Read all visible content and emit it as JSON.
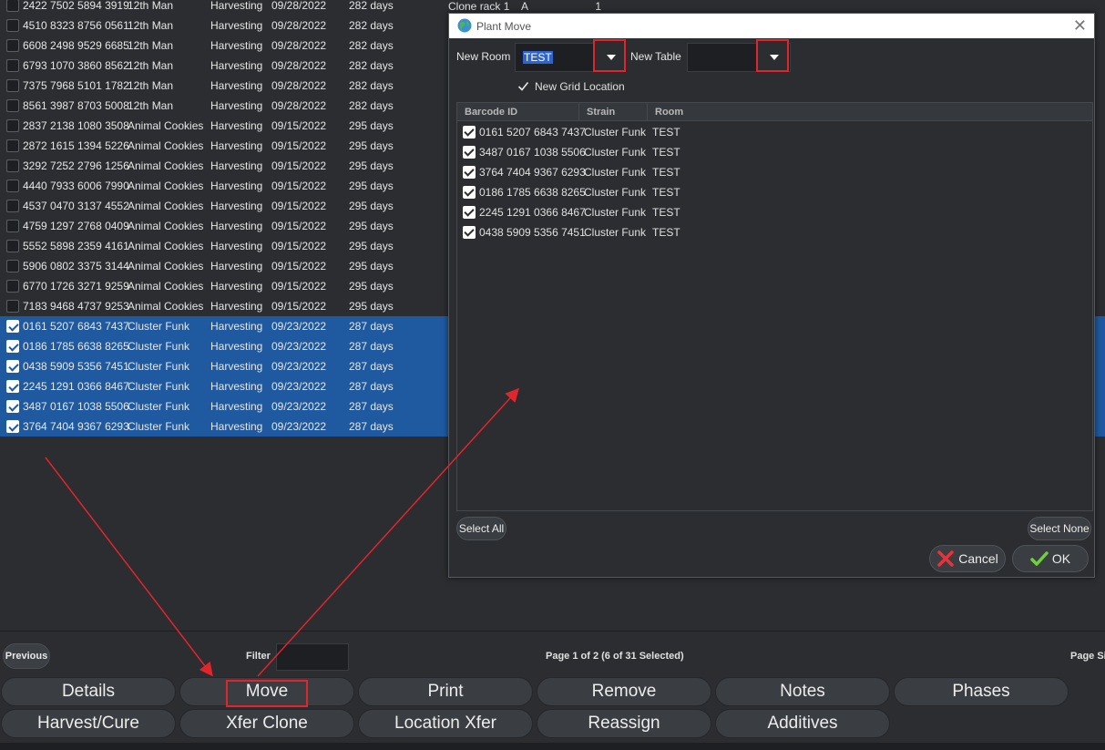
{
  "background_table": {
    "extra": [
      "Clone rack 1",
      "A",
      "1"
    ],
    "rows": [
      {
        "barcode": "2422 7502 5894 3919",
        "strain": "12th Man",
        "phase": "Harvesting",
        "date": "09/28/2022",
        "days": "282 days",
        "checked": false
      },
      {
        "barcode": "4510 8323 8756 0561",
        "strain": "12th Man",
        "phase": "Harvesting",
        "date": "09/28/2022",
        "days": "282 days",
        "checked": false
      },
      {
        "barcode": "6608 2498 9529 6685",
        "strain": "12th Man",
        "phase": "Harvesting",
        "date": "09/28/2022",
        "days": "282 days",
        "checked": false
      },
      {
        "barcode": "6793 1070 3860 8562",
        "strain": "12th Man",
        "phase": "Harvesting",
        "date": "09/28/2022",
        "days": "282 days",
        "checked": false
      },
      {
        "barcode": "7375 7968 5101 1782",
        "strain": "12th Man",
        "phase": "Harvesting",
        "date": "09/28/2022",
        "days": "282 days",
        "checked": false
      },
      {
        "barcode": "8561 3987 8703 5008",
        "strain": "12th Man",
        "phase": "Harvesting",
        "date": "09/28/2022",
        "days": "282 days",
        "checked": false
      },
      {
        "barcode": "2837 2138 1080 3508",
        "strain": "Animal Cookies",
        "phase": "Harvesting",
        "date": "09/15/2022",
        "days": "295 days",
        "checked": false
      },
      {
        "barcode": "2872 1615 1394 5226",
        "strain": "Animal Cookies",
        "phase": "Harvesting",
        "date": "09/15/2022",
        "days": "295 days",
        "checked": false
      },
      {
        "barcode": "3292 7252 2796 1256",
        "strain": "Animal Cookies",
        "phase": "Harvesting",
        "date": "09/15/2022",
        "days": "295 days",
        "checked": false
      },
      {
        "barcode": "4440 7933 6006 7990",
        "strain": "Animal Cookies",
        "phase": "Harvesting",
        "date": "09/15/2022",
        "days": "295 days",
        "checked": false
      },
      {
        "barcode": "4537 0470 3137 4552",
        "strain": "Animal Cookies",
        "phase": "Harvesting",
        "date": "09/15/2022",
        "days": "295 days",
        "checked": false
      },
      {
        "barcode": "4759 1297 2768 0409",
        "strain": "Animal Cookies",
        "phase": "Harvesting",
        "date": "09/15/2022",
        "days": "295 days",
        "checked": false
      },
      {
        "barcode": "5552 5898 2359 4161",
        "strain": "Animal Cookies",
        "phase": "Harvesting",
        "date": "09/15/2022",
        "days": "295 days",
        "checked": false
      },
      {
        "barcode": "5906 0802 3375 3144",
        "strain": "Animal Cookies",
        "phase": "Harvesting",
        "date": "09/15/2022",
        "days": "295 days",
        "checked": false
      },
      {
        "barcode": "6770 1726 3271 9259",
        "strain": "Animal Cookies",
        "phase": "Harvesting",
        "date": "09/15/2022",
        "days": "295 days",
        "checked": false
      },
      {
        "barcode": "7183 9468 4737 9253",
        "strain": "Animal Cookies",
        "phase": "Harvesting",
        "date": "09/15/2022",
        "days": "295 days",
        "checked": false
      },
      {
        "barcode": "0161 5207 6843 7437",
        "strain": "Cluster Funk",
        "phase": "Harvesting",
        "date": "09/23/2022",
        "days": "287 days",
        "checked": true
      },
      {
        "barcode": "0186 1785 6638 8265",
        "strain": "Cluster Funk",
        "phase": "Harvesting",
        "date": "09/23/2022",
        "days": "287 days",
        "checked": true
      },
      {
        "barcode": "0438 5909 5356 7451",
        "strain": "Cluster Funk",
        "phase": "Harvesting",
        "date": "09/23/2022",
        "days": "287 days",
        "checked": true
      },
      {
        "barcode": "2245 1291 0366 8467",
        "strain": "Cluster Funk",
        "phase": "Harvesting",
        "date": "09/23/2022",
        "days": "287 days",
        "checked": true
      },
      {
        "barcode": "3487 0167 1038 5506",
        "strain": "Cluster Funk",
        "phase": "Harvesting",
        "date": "09/23/2022",
        "days": "287 days",
        "checked": true
      },
      {
        "barcode": "3764 7404 9367 6293",
        "strain": "Cluster Funk",
        "phase": "Harvesting",
        "date": "09/23/2022",
        "days": "287 days",
        "checked": true
      }
    ]
  },
  "pager": {
    "previous_label": "Previous",
    "filter_label": "Filter",
    "filter_value": "",
    "page_info": "Page 1 of 2 (6 of 31 Selected)",
    "page_size_label": "Page Si"
  },
  "actions": {
    "row1": [
      "Details",
      "Move",
      "Print",
      "Remove",
      "Notes",
      "Phases"
    ],
    "row2": [
      "Harvest/Cure",
      "Xfer Clone",
      "Location Xfer",
      "Reassign",
      "Additives"
    ]
  },
  "dialog": {
    "title": "Plant Move",
    "close_glyph": "✕",
    "new_room_label": "New Room",
    "new_room_value": "TEST",
    "new_table_label": "New Table",
    "new_table_value": "",
    "new_grid_label": "New Grid Location",
    "new_grid_checked": true,
    "columns": [
      "Barcode ID",
      "Strain",
      "Room"
    ],
    "rows": [
      {
        "barcode": "0161 5207 6843 7437",
        "strain": "Cluster Funk",
        "room": "TEST"
      },
      {
        "barcode": "3487 0167 1038 5506",
        "strain": "Cluster Funk",
        "room": "TEST"
      },
      {
        "barcode": "3764 7404 9367 6293",
        "strain": "Cluster Funk",
        "room": "TEST"
      },
      {
        "barcode": "0186 1785 6638 8265",
        "strain": "Cluster Funk",
        "room": "TEST"
      },
      {
        "barcode": "2245 1291 0366 8467",
        "strain": "Cluster Funk",
        "room": "TEST"
      },
      {
        "barcode": "0438 5909 5356 7451",
        "strain": "Cluster Funk",
        "room": "TEST"
      }
    ],
    "select_all_label": "Select All",
    "select_none_label": "Select None",
    "cancel_label": "Cancel",
    "ok_label": "OK"
  },
  "colors": {
    "selection": "#1f5aa0",
    "highlight_red": "#e0252d",
    "cancel_x": "#e8333a",
    "ok_check": "#6fd13a"
  }
}
